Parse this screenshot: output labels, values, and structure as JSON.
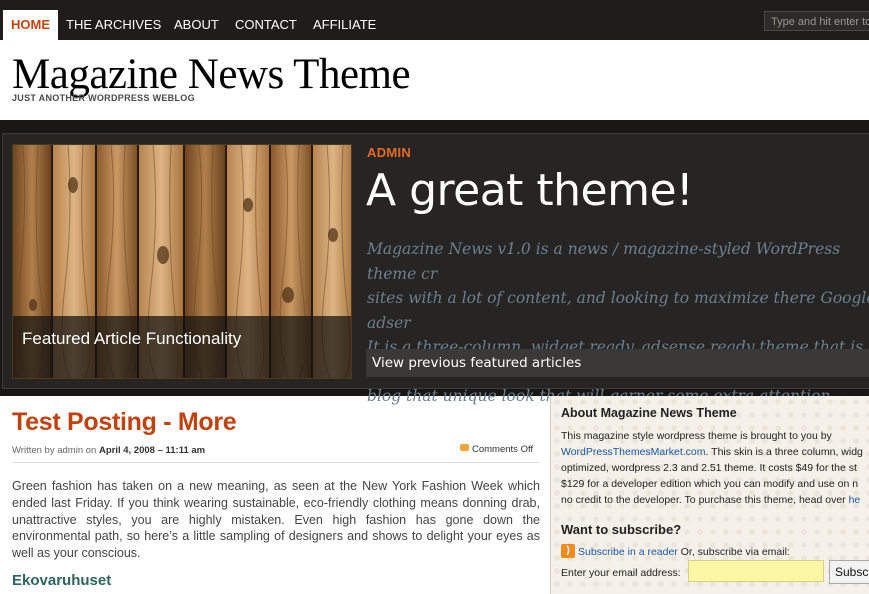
{
  "nav": {
    "items": [
      {
        "label": "HOME",
        "active": true
      },
      {
        "label": "THE ARCHIVES"
      },
      {
        "label": "ABOUT"
      },
      {
        "label": "CONTACT"
      },
      {
        "label": "AFFILIATE"
      }
    ],
    "search_placeholder": "Type and hit enter to"
  },
  "header": {
    "title": "Magazine News Theme",
    "tagline": "JUST ANOTHER WORDPRESS WEBLOG"
  },
  "featured": {
    "image_caption": "Featured Article Functionality",
    "author": "ADMIN",
    "title": "A great theme!",
    "excerpt": "Magazine News v1.0 is a news / magazine-styled WordPress theme cr\nsites with a lot of content, and looking to maximize there Google adser\nIt is a three-column, widget ready, adsense ready theme that is sure t\nblog that unique look that will garner some extra attention.",
    "previous_link": "View previous featured articles"
  },
  "post": {
    "title": "Test Posting - More",
    "meta_prefix": "Written by admin on ",
    "date": "April 4, 2008 – 11:11 am",
    "comments": "Comments Off",
    "body": "Green fashion has taken on a new meaning, as seen at the New York Fashion Week which ended last Friday. If you think wearing sustainable, eco-friendly clothing means donning drab, unattractive styles, you are highly mistaken. Even high fashion has gone down the environmental path, so here’s a little sampling of designers and shows to delight your eyes as well as your conscious.",
    "subheading": "Ekovaruhuset"
  },
  "sidebar": {
    "about_title": "About Magazine News Theme",
    "about_line1": "This magazine style wordpress theme is brought to you by",
    "about_link": "WordPressThemesMarket.com",
    "about_rest": ". This skin is a three column, widg\noptimized, wordpress 2.3 and 2.51 theme. It costs $49 for the st\n$129 for a developer edition which you can modify and use on n\nno credit to the developer. To purchase this theme, head over",
    "about_tail_link": "he",
    "subscribe_title": "Want to subscribe?",
    "rss_link": "Subscribe in a reader",
    "rss_suffix": " Or, subscribe via email:",
    "email_label": "Enter your email address:",
    "email_value": "",
    "subscribe_button": "Subsc"
  },
  "colors": {
    "accent_orange": "#c2420d",
    "nav_bg": "#1f1d1c",
    "featured_bg": "#262524",
    "subheading_teal": "#2d6363",
    "email_input_bg": "#fbf7a4"
  }
}
